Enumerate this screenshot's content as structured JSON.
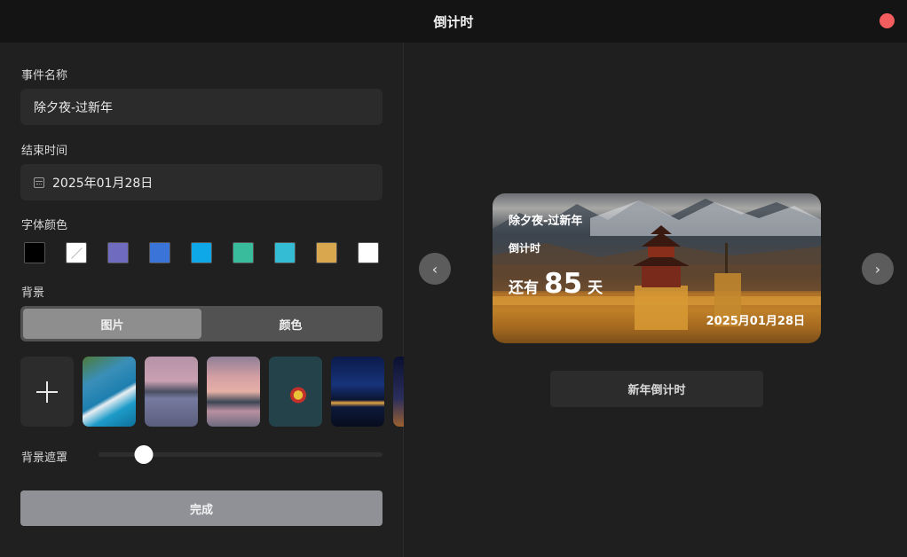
{
  "window": {
    "title": "倒计时"
  },
  "form": {
    "event_label": "事件名称",
    "event_value": "除夕夜-过新年",
    "end_label": "结束时间",
    "end_value": "2025年01月28日",
    "color_label": "字体颜色",
    "colors": [
      "#000000",
      "#ffffff",
      "#6f6bbf",
      "#3b74d8",
      "#0ea7e8",
      "#38bc9b",
      "#33bcd4",
      "#d9a74e",
      "#ffffff"
    ],
    "bg_label": "背景",
    "bg_tabs": [
      "图片",
      "颜色"
    ],
    "mask_label": "背景遮罩",
    "mask_value": 0.16,
    "done_label": "完成"
  },
  "preview": {
    "event_name": "除夕夜-过新年",
    "subtitle": "倒计时",
    "prefix": "还有",
    "days": "85",
    "suffix": "天",
    "date": "2025月01月28日",
    "preset_label": "新年倒计时",
    "prev_icon": "chevron-left-icon",
    "next_icon": "chevron-right-icon"
  }
}
